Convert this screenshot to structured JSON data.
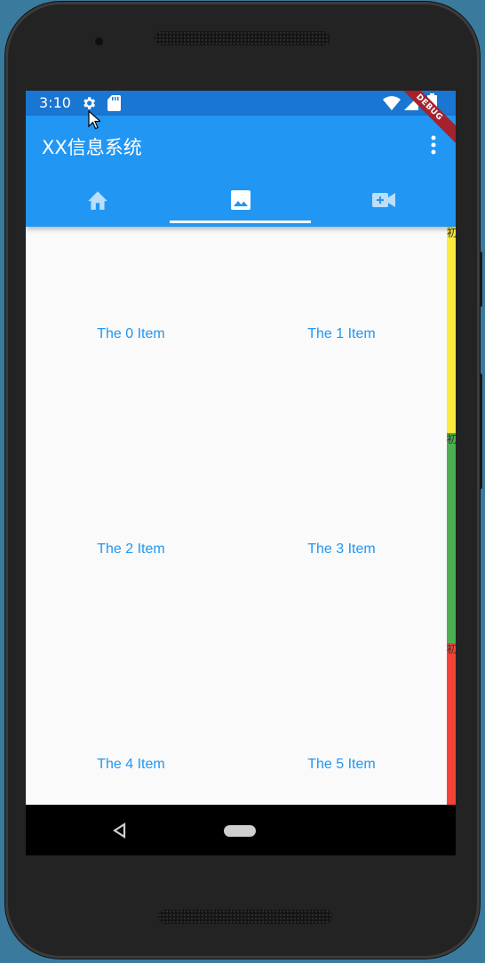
{
  "status_bar": {
    "time": "3:10",
    "icons": [
      "gear-icon",
      "sd-card-icon",
      "wifi-icon",
      "signal-icon",
      "battery-icon"
    ]
  },
  "app_bar": {
    "title": "XX信息系统",
    "menu_icon": "more-vertical-icon",
    "debug_banner": "DEBUG"
  },
  "tabs": [
    {
      "icon": "home-icon",
      "selected": false
    },
    {
      "icon": "image-icon",
      "selected": true
    },
    {
      "icon": "video-call-icon",
      "selected": false
    }
  ],
  "grid": {
    "items": [
      "The 0 Item",
      "The 1 Item",
      "The 2 Item",
      "The 3 Item",
      "The 4 Item",
      "The 5 Item"
    ]
  },
  "side_strips": [
    {
      "label": "初",
      "color": "#ffeb3b"
    },
    {
      "label": "初",
      "color": "#4caf50"
    },
    {
      "label": "初",
      "color": "#f44336"
    }
  ],
  "nav_bar": {
    "icons": [
      "back-icon",
      "home-pill-icon"
    ]
  },
  "colors": {
    "primary": "#2196f3",
    "primary_dark": "#1976d2",
    "accent_text": "#2196f3"
  }
}
